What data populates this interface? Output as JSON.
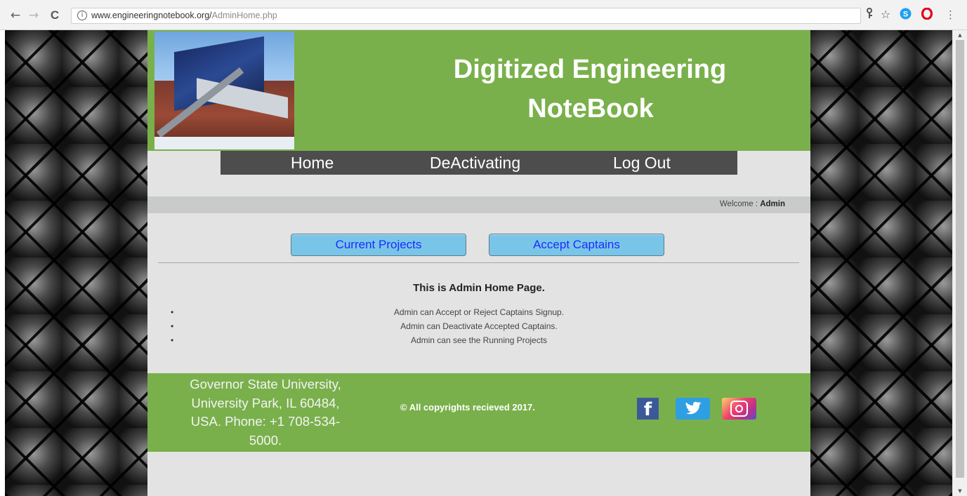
{
  "browser": {
    "back_glyph": "←",
    "forward_glyph": "→",
    "reload_glyph": "C",
    "info_glyph": "i",
    "url_host": "www.engineeringnotebook.org/",
    "url_path": "AdminHome.php",
    "icons": [
      "back-icon",
      "forward-icon",
      "reload-icon",
      "info-icon",
      "key-icon",
      "star-icon",
      "skype-icon",
      "opera-icon",
      "menu-icon"
    ]
  },
  "header": {
    "title_line1": "Digitized Engineering",
    "title_line2": "NoteBook"
  },
  "menu": {
    "items": [
      {
        "label": "Home"
      },
      {
        "label": "DeActivating"
      },
      {
        "label": "Log Out"
      }
    ]
  },
  "welcome": {
    "label": "Welcome : ",
    "user": "Admin"
  },
  "actions": {
    "current_projects": "Current Projects",
    "accept_captains": "Accept Captains"
  },
  "content": {
    "heading": "This is Admin Home Page.",
    "bullets": [
      "Admin can Accept or Reject Captains Signup.",
      "Admin can Deactivate Accepted Captains.",
      "Admin can see the Running Projects"
    ]
  },
  "footer": {
    "address_line1": "Governor State University,",
    "address_line2": "University Park, IL 60484,",
    "address_line3": "USA. Phone: +1 708-534-",
    "address_line4": "5000.",
    "copyright": "© All copyrights recieved 2017.",
    "social": [
      "facebook-icon",
      "twitter-icon",
      "instagram-icon"
    ]
  },
  "colors": {
    "header_green": "#79b04b",
    "menu_gray": "#4d4d4d",
    "button_blue": "#79c5e8",
    "button_text": "#1a2cff"
  }
}
